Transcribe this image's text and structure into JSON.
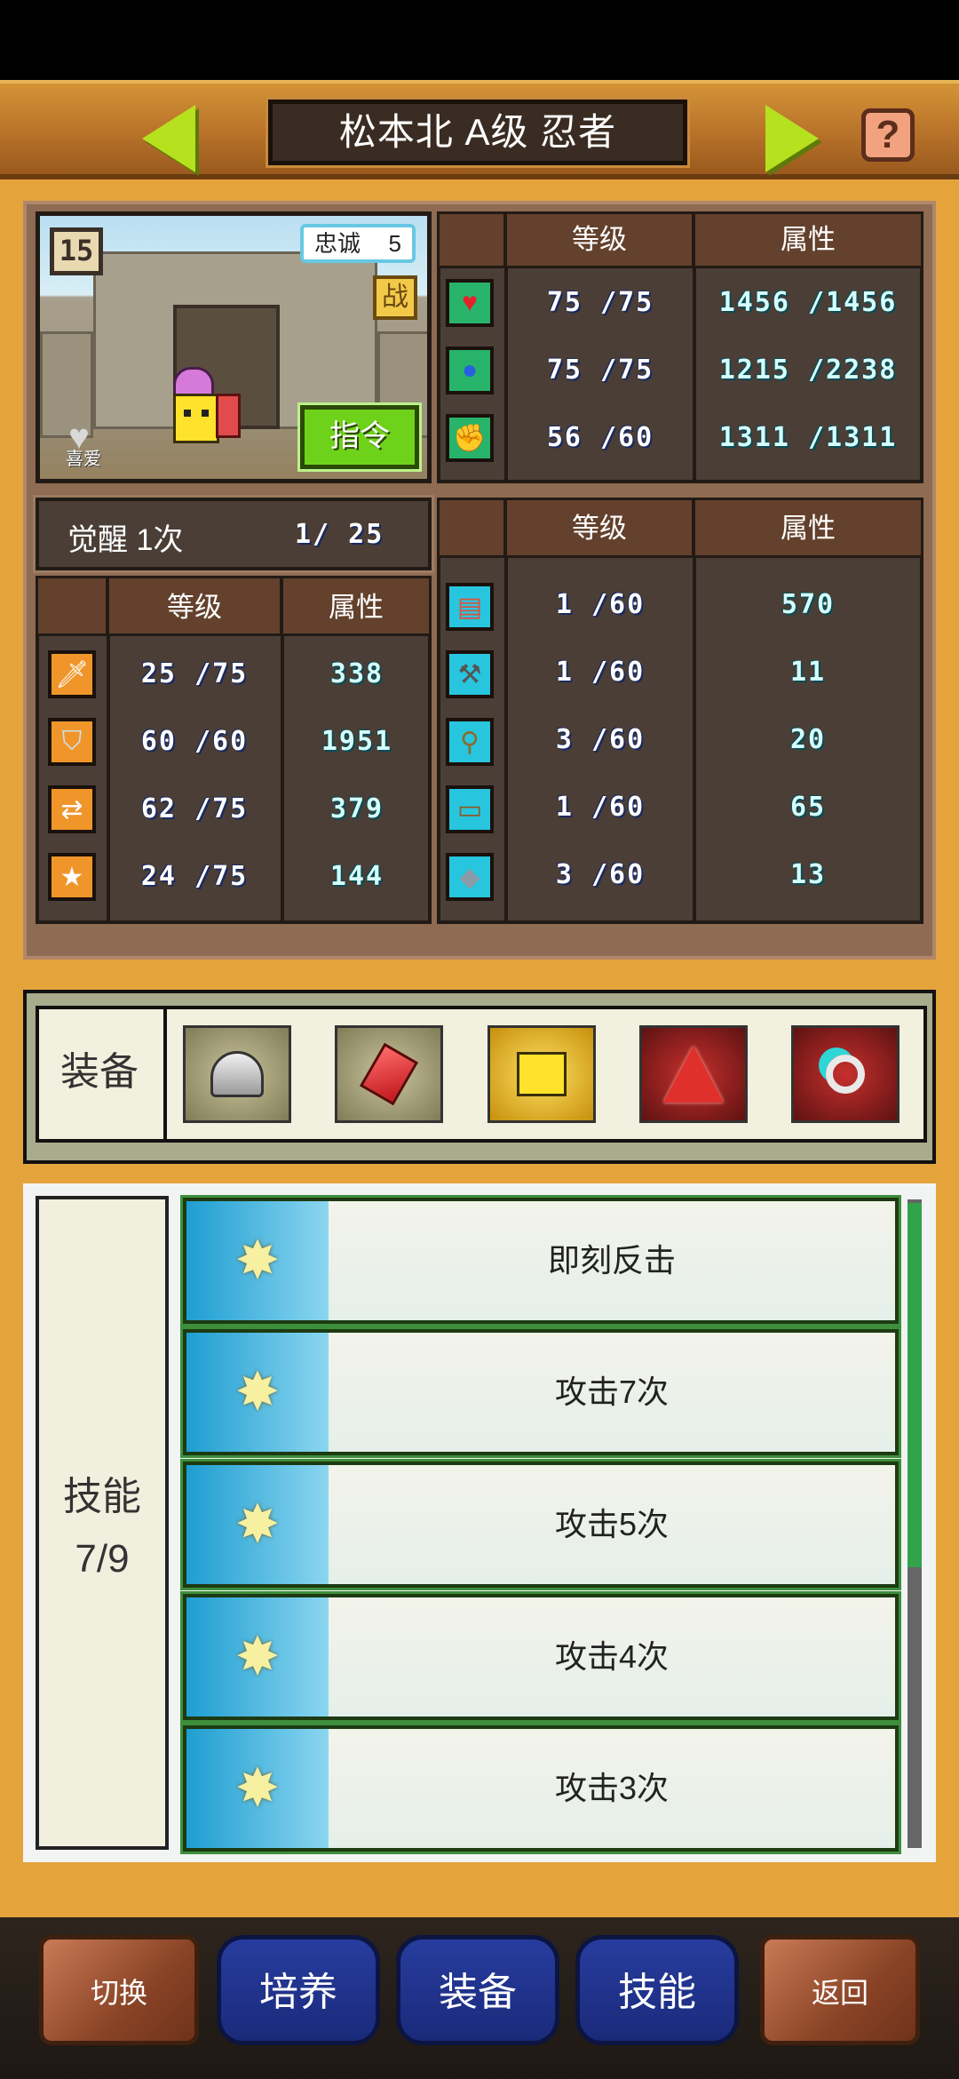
{
  "header": {
    "title": "松本北 A级 忍者",
    "help_label": "?"
  },
  "portrait": {
    "level_badge": "15",
    "loyalty_label": "忠诚",
    "loyalty_value": "5",
    "battle_badge": "战",
    "command_button": "指令",
    "favorite_label": "喜爱"
  },
  "main_stats": {
    "headers": {
      "level": "等级",
      "attribute": "属性"
    },
    "rows": [
      {
        "icon": "heart-icon",
        "level": "75 /75",
        "value": "1456 /1456"
      },
      {
        "icon": "mana-potion-icon",
        "level": "75 /75",
        "value": "1215 /2238"
      },
      {
        "icon": "strength-arm-icon",
        "level": "56 /60",
        "value": "1311 /1311"
      }
    ]
  },
  "awaken": {
    "label": "觉醒 1次",
    "value": "1/ 25"
  },
  "combat_stats": {
    "headers": {
      "level": "等级",
      "attribute": "属性"
    },
    "rows": [
      {
        "icon": "sword-icon",
        "level": "25 /75",
        "value": "338"
      },
      {
        "icon": "shield-icon",
        "level": "60 /60",
        "value": "1951"
      },
      {
        "icon": "crossed-arrows-icon",
        "level": "62 /75",
        "value": "379"
      },
      {
        "icon": "star-icon",
        "level": "24 /75",
        "value": "144"
      }
    ]
  },
  "craft_stats": {
    "headers": {
      "level": "等级",
      "attribute": "属性"
    },
    "rows": [
      {
        "icon": "book-icon",
        "level": "1 /60",
        "value": "570"
      },
      {
        "icon": "hammer-icon",
        "level": "1 /60",
        "value": "11"
      },
      {
        "icon": "shovel-icon",
        "level": "3 /60",
        "value": "20"
      },
      {
        "icon": "anvil-icon",
        "level": "1 /60",
        "value": "65"
      },
      {
        "icon": "crystal-icon",
        "level": "3 /60",
        "value": "13"
      }
    ]
  },
  "equipment": {
    "label": "装备",
    "slots": [
      {
        "icon": "helmet-icon"
      },
      {
        "icon": "red-gem-icon"
      },
      {
        "icon": "robot-face-icon"
      },
      {
        "icon": "red-cape-icon"
      },
      {
        "icon": "ring-icon"
      }
    ]
  },
  "skills": {
    "label": "技能",
    "count": "7/9",
    "items": [
      {
        "name": "即刻反击"
      },
      {
        "name": "攻击7次"
      },
      {
        "name": "攻击5次"
      },
      {
        "name": "攻击4次"
      },
      {
        "name": "攻击3次"
      }
    ]
  },
  "nav": {
    "switch": "切换",
    "train": "培养",
    "equip": "装备",
    "skill": "技能",
    "back": "返回"
  }
}
